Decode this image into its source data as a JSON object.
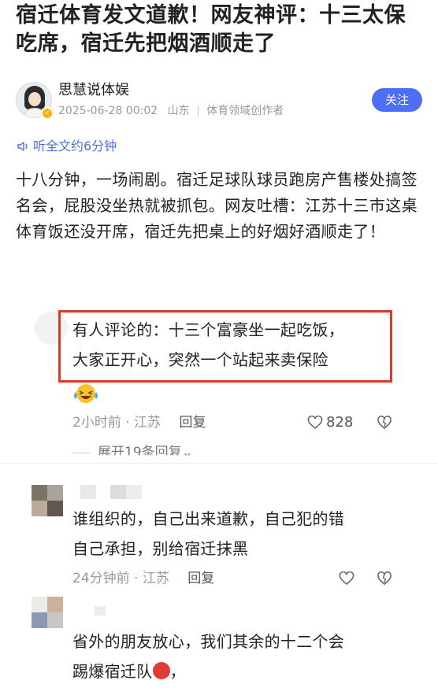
{
  "article": {
    "title": "宿迁体育发文道歉！网友神评：十三太保吃席，宿迁先把烟酒顺走了",
    "author": {
      "name": "思慧说体娱",
      "date": "2025-06-28 00:02",
      "location": "山东",
      "tag": "体育领域创作者",
      "follow_label": "关注"
    },
    "listen_label": "听全文约6分钟",
    "body": "十八分钟，一场闹剧。宿迁足球队球员跑房产售楼处搞签名会，屁股没坐热就被抓包。网友吐槽：江苏十三市这桌体育饭还没开席，宿迁先把桌上的好烟好酒顺走了！"
  },
  "comments": [
    {
      "text_line1": "有人评论的：十三个富豪坐一起吃饭，",
      "text_line2": "大家正开心，突然一个站起来卖保险",
      "time": "2小时前",
      "location": "江苏",
      "reply_label": "回复",
      "likes": "828",
      "expand_label": "展开19条回复"
    },
    {
      "text_line1": "谁组织的，自己出来道歉，自己犯的错",
      "text_line2": "自己承担，别给宿迁抹黑",
      "time": "24分钟前",
      "location": "江苏",
      "reply_label": "回复"
    },
    {
      "text_line1": "省外的朋友放心，我们其余的十二个会",
      "text_line2": "踢爆宿迁队",
      "text_line2_suffix": "，"
    }
  ],
  "colors": {
    "accent": "#4f6ef7",
    "listen": "#4d6fd8",
    "highlight_border": "#d93a2a",
    "meta": "#999999"
  }
}
